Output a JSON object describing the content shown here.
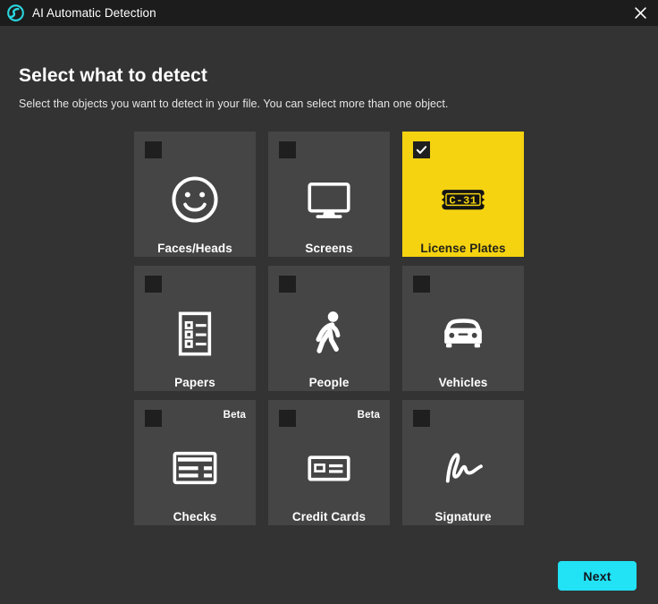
{
  "window": {
    "title": "AI Automatic Detection",
    "logo_icon": "ai-swirl-logo-icon",
    "close_icon": "close-icon"
  },
  "content": {
    "heading": "Select what to detect",
    "subheading": "Select the objects you want to detect in your file. You can select more than one object."
  },
  "colors": {
    "titlebar_bg": "#1c1c1c",
    "body_bg": "#333333",
    "card_bg": "#454545",
    "card_selected_bg": "#f5d310",
    "checkbox_bg": "#1f1f1f",
    "accent": "#22e2f5",
    "text": "#ffffff"
  },
  "cards": [
    {
      "id": "faces-heads",
      "label": "Faces/Heads",
      "icon": "smiley-face-icon",
      "selected": false,
      "beta": null
    },
    {
      "id": "screens",
      "label": "Screens",
      "icon": "monitor-icon",
      "selected": false,
      "beta": null
    },
    {
      "id": "license-plates",
      "label": "License Plates",
      "icon": "license-plate-icon",
      "selected": true,
      "beta": null,
      "plate_text": "C-31"
    },
    {
      "id": "papers",
      "label": "Papers",
      "icon": "document-list-icon",
      "selected": false,
      "beta": null
    },
    {
      "id": "people",
      "label": "People",
      "icon": "walking-person-icon",
      "selected": false,
      "beta": null
    },
    {
      "id": "vehicles",
      "label": "Vehicles",
      "icon": "car-icon",
      "selected": false,
      "beta": null
    },
    {
      "id": "checks",
      "label": "Checks",
      "icon": "check-document-icon",
      "selected": false,
      "beta": "Beta"
    },
    {
      "id": "credit-cards",
      "label": "Credit Cards",
      "icon": "credit-card-icon",
      "selected": false,
      "beta": "Beta"
    },
    {
      "id": "signature",
      "label": "Signature",
      "icon": "signature-icon",
      "selected": false,
      "beta": null
    }
  ],
  "footer": {
    "next_label": "Next"
  }
}
